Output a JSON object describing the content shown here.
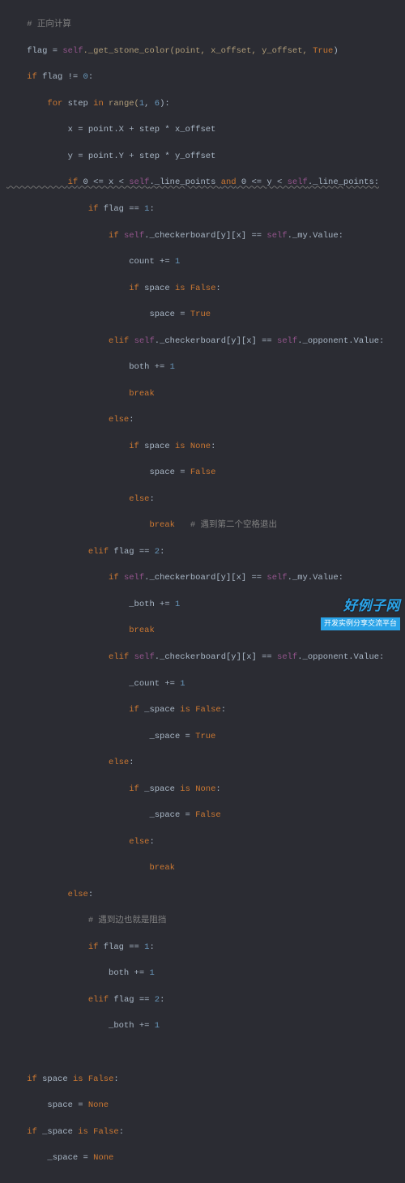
{
  "code": {
    "l01_comment": "# 正向计算",
    "l02_a": "flag = ",
    "l02_b": "self",
    "l02_c": "._get_stone_color(point, x_offset, y_offset, ",
    "l02_d": "True",
    "l02_e": ")",
    "l03_a": "if",
    "l03_b": " flag != ",
    "l03_c": "0",
    "l03_d": ":",
    "l04_a": "for",
    "l04_b": " step ",
    "l04_c": "in",
    "l04_d": " range(",
    "l04_e": "1",
    "l04_f": ", ",
    "l04_g": "6",
    "l04_h": "):",
    "l05": "x = point.X + step * x_offset",
    "l06": "y = point.Y + step * y_offset",
    "l07_a": "if",
    "l07_b": " 0 <= x < ",
    "l07_c": "self",
    "l07_d": "._line_points ",
    "l07_e": "and",
    "l07_f": " 0 <= y < ",
    "l07_g": "self",
    "l07_h": "._line_points:",
    "l08_a": "if",
    "l08_b": " flag == ",
    "l08_c": "1",
    "l08_d": ":",
    "l09_a": "if",
    "l09_b": " ",
    "l09_c": "self",
    "l09_d": "._checkerboard[y][x] == ",
    "l09_e": "self",
    "l09_f": "._my.Value:",
    "l10": "count += ",
    "l10_n": "1",
    "l11_a": "if",
    "l11_b": " space ",
    "l11_c": "is",
    "l11_d": " ",
    "l11_e": "False",
    "l11_f": ":",
    "l12": "space = ",
    "l12_b": "True",
    "l13_a": "elif",
    "l13_b": " ",
    "l13_c": "self",
    "l13_d": "._checkerboard[y][x] == ",
    "l13_e": "self",
    "l13_f": "._opponent.Value:",
    "l14": "both += ",
    "l14_n": "1",
    "l15": "break",
    "l16": "else",
    "l16_b": ":",
    "l17_a": "if",
    "l17_b": " space ",
    "l17_c": "is",
    "l17_d": " ",
    "l17_e": "None",
    "l17_f": ":",
    "l18": "space = ",
    "l18_b": "False",
    "l19": "else",
    "l19_b": ":",
    "l20": "break",
    "l20_c": "   # 遇到第二个空格退出",
    "l21_a": "elif",
    "l21_b": " flag == ",
    "l21_c": "2",
    "l21_d": ":",
    "l22_a": "if",
    "l22_b": " ",
    "l22_c": "self",
    "l22_d": "._checkerboard[y][x] == ",
    "l22_e": "self",
    "l22_f": "._my.Value:",
    "l23": "_both += ",
    "l23_n": "1",
    "l24": "break",
    "l25_a": "elif",
    "l25_b": " ",
    "l25_c": "self",
    "l25_d": "._checkerboard[y][x] == ",
    "l25_e": "self",
    "l25_f": "._opponent.Value:",
    "l26": "_count += ",
    "l26_n": "1",
    "l27_a": "if",
    "l27_b": " _space ",
    "l27_c": "is",
    "l27_d": " ",
    "l27_e": "False",
    "l27_f": ":",
    "l28": "_space = ",
    "l28_b": "True",
    "l29": "else",
    "l29_b": ":",
    "l30_a": "if",
    "l30_b": " _space ",
    "l30_c": "is",
    "l30_d": " ",
    "l30_e": "None",
    "l30_f": ":",
    "l31": "_space = ",
    "l31_b": "False",
    "l32": "else",
    "l32_b": ":",
    "l33": "break",
    "l34": "else",
    "l34_b": ":",
    "l35": "# 遇到边也就是阻挡",
    "l36_a": "if",
    "l36_b": " flag == ",
    "l36_c": "1",
    "l36_d": ":",
    "l37": "both += ",
    "l37_n": "1",
    "l38_a": "elif",
    "l38_b": " flag == ",
    "l38_c": "2",
    "l38_d": ":",
    "l39": "_both += ",
    "l39_n": "1",
    "l41_a": "if",
    "l41_b": " space ",
    "l41_c": "is",
    "l41_d": " ",
    "l41_e": "False",
    "l41_f": ":",
    "l42": "space = ",
    "l42_b": "None",
    "l43_a": "if",
    "l43_b": " _space ",
    "l43_c": "is",
    "l43_d": " ",
    "l43_e": "False",
    "l43_f": ":",
    "l44": "_space = ",
    "l44_b": "None"
  },
  "indent": {
    "i1": "    ",
    "i2": "        ",
    "i3": "            ",
    "i4": "                ",
    "i5": "                    ",
    "i6": "                        ",
    "i7": "                            ",
    "i8": "                                "
  },
  "watermark": {
    "line1": "好例子网",
    "line2": "开发实例分享交流平台"
  }
}
